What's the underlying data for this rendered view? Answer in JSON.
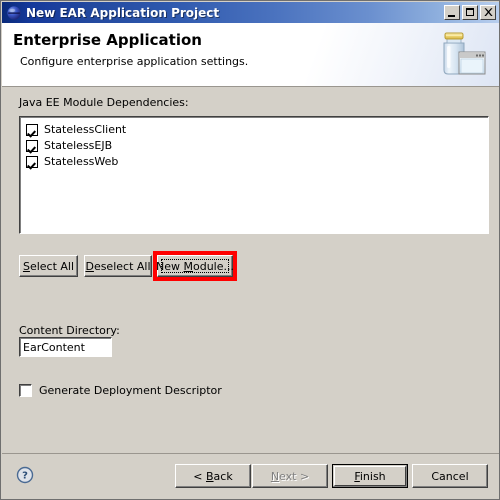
{
  "window": {
    "title": "New EAR Application Project",
    "icon": "eclipse-sphere-icon",
    "controls": {
      "minimize_label": "_",
      "maximize_label": "□",
      "close_label": "✕"
    }
  },
  "banner": {
    "title": "Enterprise Application",
    "subtitle": "Configure enterprise application settings.",
    "icon": "ear-jar-icon"
  },
  "main": {
    "modules_label": "Java EE Module Dependencies:",
    "modules": [
      {
        "label": "StatelessClient",
        "checked": true
      },
      {
        "label": "StatelessEJB",
        "checked": true
      },
      {
        "label": "StatelessWeb",
        "checked": true
      }
    ],
    "buttons": {
      "select_all": {
        "pre": "",
        "mnemonic": "S",
        "post": "elect All"
      },
      "deselect_all": {
        "pre": "",
        "mnemonic": "D",
        "post": "eselect All"
      },
      "new_module": {
        "pre": "New ",
        "mnemonic": "M",
        "post": "odule..."
      }
    },
    "content_directory_label": "Content Directory:",
    "content_directory_value": "EarContent",
    "content_directory_placeholder": "",
    "generate_descriptor_label": "Generate Deployment Descriptor",
    "generate_descriptor_checked": false
  },
  "footer": {
    "help_icon": "help-question-icon",
    "back": {
      "pre": "< ",
      "mnemonic": "B",
      "post": "ack"
    },
    "next": {
      "pre": "",
      "mnemonic": "N",
      "post": "ext >"
    },
    "finish": {
      "pre": "",
      "mnemonic": "F",
      "post": "inish"
    },
    "cancel": {
      "pre": "",
      "mnemonic": "",
      "post": "Cancel"
    }
  },
  "annotation": {
    "color": "#ff0000",
    "target": "new-module-button"
  }
}
